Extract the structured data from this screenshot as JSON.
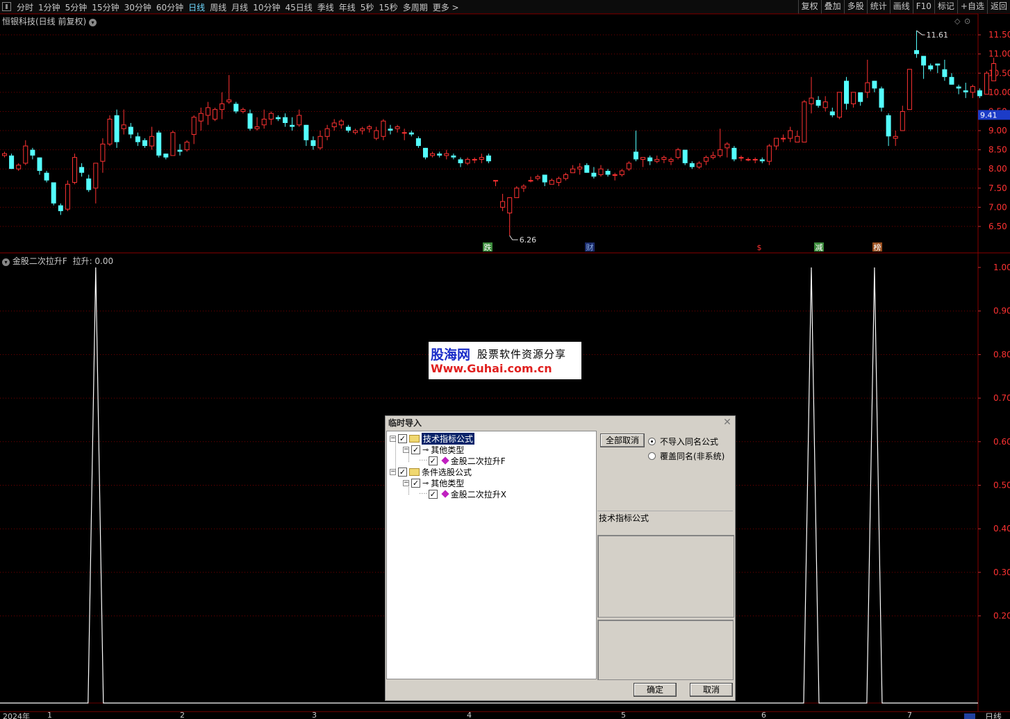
{
  "toolbar": {
    "periods": [
      "分时",
      "1分钟",
      "5分钟",
      "15分钟",
      "30分钟",
      "60分钟",
      "日线",
      "周线",
      "月线",
      "10分钟",
      "45日线",
      "季线",
      "年线",
      "5秒",
      "15秒",
      "多周期",
      "更多 >"
    ],
    "active_period": "日线",
    "right_buttons": [
      "复权",
      "叠加",
      "多股",
      "统计",
      "画线",
      "F10",
      "标记",
      "+自选",
      "返回"
    ]
  },
  "stock": {
    "title": "恒银科技(日线 前复权)"
  },
  "indicator": {
    "title": "金股二次拉升F",
    "value_label": "拉升: 0.00"
  },
  "watermark": {
    "brand": "股海网",
    "slogan": "股票软件资源分享",
    "url": "Www.Guhai.com.cn"
  },
  "dialog": {
    "title": "临时导入",
    "tree": {
      "n1": "技术指标公式",
      "n1a": "其他类型",
      "n1a1": "金股二次拉升F",
      "n2": "条件选股公式",
      "n2a": "其他类型",
      "n2a1": "金股二次拉升X"
    },
    "cancel_all": "全部取消",
    "option1": "不导入同名公式",
    "option2": "覆盖同名(非系统)",
    "description_label": "技术指标公式",
    "ok": "确定",
    "cancel": "取消"
  },
  "axis": {
    "year_label": "2024年",
    "months": [
      "1",
      "2",
      "3",
      "4",
      "5",
      "6",
      "7"
    ],
    "period_label": "日线"
  },
  "markers": [
    "跌",
    "财",
    "$",
    "减",
    "榜"
  ],
  "colors": {
    "up": "#ff3232",
    "down": "#54ffff",
    "grid": "#7a0000",
    "current_price_bg": "#1c3cc8"
  },
  "chart_data": [
    {
      "type": "candlestick",
      "title": "恒银科技(日线 前复权)",
      "y_ticks": [
        "11.50",
        "11.00",
        "10.50",
        "10.00",
        "9.50",
        "9.00",
        "8.50",
        "8.00",
        "7.50",
        "7.00",
        "6.50"
      ],
      "ylim": [
        6.1,
        11.72
      ],
      "current_price": "9.41",
      "high_label": "11.61",
      "low_label": "6.26",
      "note": "daily candles from late Dec 2023 to early Jul 2024; O,H,L,C per bar",
      "ohlc": [
        [
          8.35,
          8.45,
          8.3,
          8.4
        ],
        [
          8.35,
          8.4,
          8.0,
          8.0
        ],
        [
          8.0,
          8.15,
          7.95,
          8.1
        ],
        [
          8.15,
          8.75,
          8.1,
          8.6
        ],
        [
          8.5,
          8.55,
          8.25,
          8.35
        ],
        [
          8.3,
          8.3,
          7.85,
          7.95
        ],
        [
          7.9,
          7.95,
          7.65,
          7.7
        ],
        [
          7.65,
          7.65,
          7.05,
          7.1
        ],
        [
          7.05,
          7.1,
          6.8,
          6.9
        ],
        [
          6.95,
          7.7,
          6.9,
          7.6
        ],
        [
          7.65,
          8.4,
          7.6,
          8.3
        ],
        [
          8.05,
          8.15,
          7.8,
          7.9
        ],
        [
          7.75,
          7.85,
          7.4,
          7.45
        ],
        [
          7.5,
          8.15,
          7.1,
          8.15
        ],
        [
          8.2,
          8.8,
          7.9,
          8.65
        ],
        [
          8.65,
          9.4,
          8.6,
          9.3
        ],
        [
          9.4,
          9.55,
          8.55,
          8.7
        ],
        [
          9.05,
          9.55,
          8.9,
          9.15
        ],
        [
          9.1,
          9.2,
          8.8,
          8.9
        ],
        [
          8.85,
          8.95,
          8.6,
          8.7
        ],
        [
          8.75,
          8.8,
          8.55,
          8.6
        ],
        [
          8.6,
          9.1,
          8.5,
          8.85
        ],
        [
          8.95,
          9.0,
          8.3,
          8.35
        ],
        [
          8.4,
          8.4,
          8.25,
          8.3
        ],
        [
          8.35,
          9.0,
          8.35,
          8.95
        ],
        [
          8.5,
          8.65,
          8.35,
          8.45
        ],
        [
          8.5,
          8.75,
          8.45,
          8.7
        ],
        [
          8.9,
          9.4,
          8.65,
          9.35
        ],
        [
          9.25,
          9.6,
          9.0,
          9.45
        ],
        [
          9.4,
          9.75,
          9.15,
          9.6
        ],
        [
          9.3,
          9.6,
          9.25,
          9.55
        ],
        [
          9.55,
          10.0,
          9.3,
          9.7
        ],
        [
          9.75,
          10.45,
          9.7,
          9.8
        ],
        [
          9.7,
          9.75,
          9.45,
          9.5
        ],
        [
          9.5,
          9.6,
          9.45,
          9.55
        ],
        [
          9.45,
          9.55,
          9.0,
          9.05
        ],
        [
          9.05,
          9.35,
          9.0,
          9.1
        ],
        [
          9.15,
          9.55,
          9.05,
          9.3
        ],
        [
          9.3,
          9.5,
          9.15,
          9.45
        ],
        [
          9.35,
          9.4,
          9.25,
          9.3
        ],
        [
          9.35,
          9.45,
          9.1,
          9.2
        ],
        [
          9.15,
          9.35,
          9.0,
          9.1
        ],
        [
          9.15,
          9.55,
          9.1,
          9.4
        ],
        [
          9.15,
          9.15,
          8.6,
          8.75
        ],
        [
          8.75,
          8.85,
          8.5,
          8.6
        ],
        [
          8.55,
          9.0,
          8.5,
          8.85
        ],
        [
          8.85,
          9.15,
          8.75,
          9.05
        ],
        [
          9.1,
          9.3,
          9.0,
          9.2
        ],
        [
          9.15,
          9.3,
          9.05,
          9.25
        ],
        [
          9.1,
          9.15,
          8.95,
          9.0
        ],
        [
          8.95,
          9.05,
          8.9,
          9.0
        ],
        [
          9.0,
          9.1,
          8.9,
          9.05
        ],
        [
          9.05,
          9.15,
          8.95,
          9.1
        ],
        [
          8.8,
          9.1,
          8.75,
          9.0
        ],
        [
          8.85,
          9.3,
          8.75,
          9.25
        ],
        [
          9.05,
          9.15,
          8.9,
          9.0
        ],
        [
          9.05,
          9.15,
          8.95,
          9.1
        ],
        [
          8.95,
          9.05,
          8.75,
          8.95
        ],
        [
          8.95,
          9.0,
          8.85,
          8.9
        ],
        [
          8.8,
          8.85,
          8.55,
          8.6
        ],
        [
          8.55,
          8.55,
          8.25,
          8.3
        ],
        [
          8.35,
          8.45,
          8.3,
          8.4
        ],
        [
          8.4,
          8.45,
          8.3,
          8.35
        ],
        [
          8.35,
          8.5,
          8.25,
          8.4
        ],
        [
          8.35,
          8.4,
          8.25,
          8.3
        ],
        [
          8.25,
          8.3,
          8.05,
          8.15
        ],
        [
          8.15,
          8.3,
          8.1,
          8.25
        ],
        [
          8.25,
          8.3,
          8.15,
          8.25
        ],
        [
          8.25,
          8.4,
          8.15,
          8.3
        ],
        [
          8.35,
          8.4,
          8.15,
          8.2
        ],
        [
          7.7,
          7.7,
          7.55,
          7.7
        ],
        [
          7.0,
          7.35,
          6.9,
          7.15
        ],
        [
          6.85,
          7.25,
          6.26,
          7.25
        ],
        [
          7.25,
          7.55,
          7.25,
          7.5
        ],
        [
          7.5,
          7.6,
          7.4,
          7.55
        ],
        [
          7.7,
          7.8,
          7.65,
          7.7
        ],
        [
          7.75,
          7.85,
          7.7,
          7.8
        ],
        [
          7.85,
          7.85,
          7.55,
          7.65
        ],
        [
          7.6,
          7.75,
          7.6,
          7.7
        ],
        [
          7.65,
          7.8,
          7.55,
          7.75
        ],
        [
          7.75,
          7.9,
          7.7,
          7.85
        ],
        [
          7.9,
          8.1,
          7.9,
          8.0
        ],
        [
          8.0,
          8.15,
          7.85,
          8.05
        ],
        [
          8.1,
          8.15,
          7.9,
          7.9
        ],
        [
          7.9,
          8.05,
          7.75,
          7.8
        ],
        [
          7.85,
          8.1,
          7.8,
          8.0
        ],
        [
          7.95,
          8.0,
          7.8,
          7.85
        ],
        [
          7.85,
          7.9,
          7.7,
          7.85
        ],
        [
          7.85,
          8.0,
          7.8,
          7.95
        ],
        [
          8.0,
          8.2,
          7.95,
          8.15
        ],
        [
          8.45,
          9.0,
          8.2,
          8.25
        ],
        [
          8.25,
          8.25,
          8.05,
          8.3
        ],
        [
          8.3,
          8.35,
          8.1,
          8.2
        ],
        [
          8.2,
          8.35,
          8.15,
          8.25
        ],
        [
          8.25,
          8.35,
          8.15,
          8.3
        ],
        [
          8.2,
          8.3,
          8.1,
          8.25
        ],
        [
          8.3,
          8.55,
          8.25,
          8.5
        ],
        [
          8.5,
          8.5,
          8.1,
          8.15
        ],
        [
          8.15,
          8.2,
          8.0,
          8.05
        ],
        [
          8.05,
          8.2,
          8.0,
          8.15
        ],
        [
          8.2,
          8.35,
          8.1,
          8.3
        ],
        [
          8.3,
          8.45,
          8.25,
          8.35
        ],
        [
          8.35,
          9.05,
          8.3,
          8.5
        ],
        [
          8.55,
          8.7,
          8.3,
          8.65
        ],
        [
          8.55,
          8.6,
          8.2,
          8.25
        ],
        [
          8.3,
          8.35,
          8.2,
          8.3
        ],
        [
          8.25,
          8.3,
          8.2,
          8.25
        ],
        [
          8.25,
          8.3,
          8.15,
          8.25
        ],
        [
          8.25,
          8.3,
          8.15,
          8.2
        ],
        [
          8.2,
          8.65,
          8.1,
          8.6
        ],
        [
          8.6,
          8.8,
          8.5,
          8.8
        ],
        [
          8.8,
          8.9,
          8.7,
          8.8
        ],
        [
          8.8,
          9.1,
          8.7,
          9.0
        ],
        [
          8.7,
          9.0,
          8.7,
          8.85
        ],
        [
          8.7,
          9.8,
          8.7,
          9.75
        ],
        [
          9.7,
          10.4,
          9.45,
          9.85
        ],
        [
          9.8,
          9.9,
          9.6,
          9.65
        ],
        [
          9.6,
          9.9,
          9.5,
          9.75
        ],
        [
          9.5,
          9.6,
          9.35,
          9.4
        ],
        [
          9.35,
          10.0,
          9.3,
          10.0
        ],
        [
          10.3,
          10.4,
          9.55,
          9.7
        ],
        [
          9.7,
          10.0,
          9.6,
          10.0
        ],
        [
          10.0,
          10.0,
          9.65,
          9.75
        ],
        [
          10.0,
          10.85,
          9.85,
          10.25
        ],
        [
          10.3,
          10.3,
          10.0,
          10.1
        ],
        [
          10.1,
          10.15,
          9.5,
          9.6
        ],
        [
          9.4,
          9.45,
          8.6,
          8.85
        ],
        [
          8.8,
          9.0,
          8.6,
          8.85
        ],
        [
          9.0,
          9.65,
          9.0,
          9.5
        ],
        [
          9.55,
          10.55,
          9.55,
          10.6
        ],
        [
          11.1,
          11.61,
          10.9,
          11.0
        ],
        [
          10.95,
          10.95,
          10.35,
          10.7
        ],
        [
          10.7,
          10.75,
          10.55,
          10.6
        ],
        [
          10.75,
          10.75,
          10.5,
          10.7
        ],
        [
          10.6,
          10.85,
          10.3,
          10.4
        ],
        [
          10.4,
          10.5,
          10.2,
          10.2
        ],
        [
          10.15,
          10.2,
          9.95,
          10.1
        ],
        [
          10.05,
          10.25,
          9.85,
          10.0
        ],
        [
          10.0,
          10.2,
          9.85,
          10.15
        ],
        [
          10.05,
          10.1,
          9.85,
          9.9
        ],
        [
          9.95,
          10.55,
          9.95,
          10.5
        ],
        [
          10.3,
          10.9,
          10.3,
          10.75
        ]
      ]
    },
    {
      "type": "line",
      "title": "金股二次拉升F",
      "series": [
        {
          "name": "拉升",
          "values": "0 everywhere except spikes"
        }
      ],
      "spikes_at_dates": [
        "2024-01 early",
        "2024-06 mid",
        "2024-06 late"
      ],
      "spike_value": 1.0,
      "y_ticks": [
        "1.00",
        "0.90",
        "0.80",
        "0.70",
        "0.60",
        "0.50",
        "0.40",
        "0.30",
        "0.20"
      ],
      "ylim": [
        0,
        1.0
      ]
    }
  ]
}
